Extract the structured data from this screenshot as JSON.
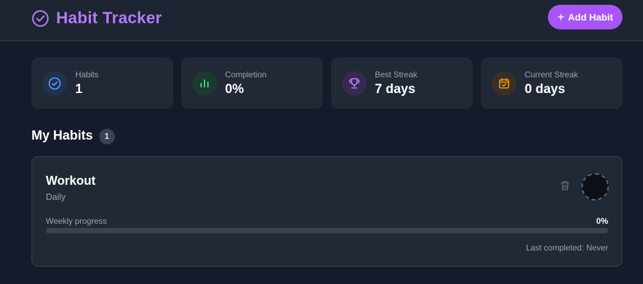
{
  "header": {
    "title": "Habit Tracker",
    "add_button_label": "Add Habit",
    "brand_color": "#a855f7"
  },
  "stats": [
    {
      "label": "Habits",
      "value": "1",
      "icon": "check-circle-icon",
      "color": "#60a5fa"
    },
    {
      "label": "Completion",
      "value": "0%",
      "icon": "bar-chart-icon",
      "color": "#4ade80"
    },
    {
      "label": "Best Streak",
      "value": "7 days",
      "icon": "trophy-icon",
      "color": "#c084fc"
    },
    {
      "label": "Current Streak",
      "value": "0 days",
      "icon": "calendar-check-icon",
      "color": "#f59e0b"
    }
  ],
  "habits_section": {
    "title": "My Habits",
    "count": "1"
  },
  "habits": [
    {
      "name": "Workout",
      "frequency": "Daily",
      "progress_label": "Weekly progress",
      "progress_text": "0%",
      "progress": 0,
      "last_completed": "Last completed: Never"
    }
  ]
}
